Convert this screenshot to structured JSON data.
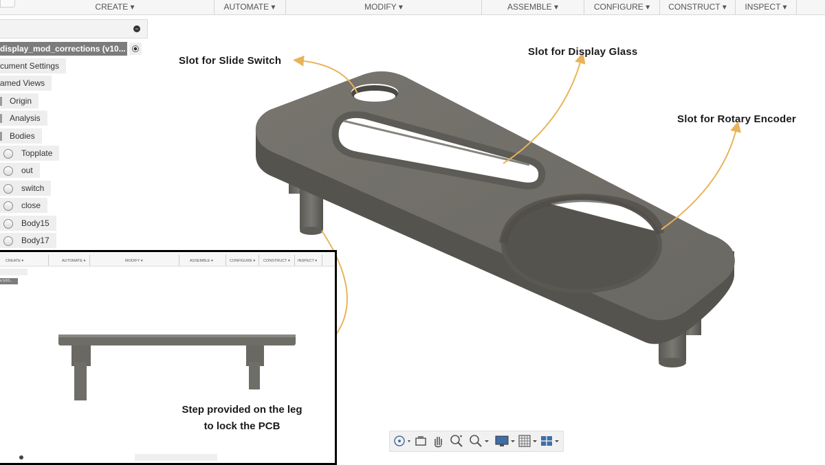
{
  "toolbar": {
    "menus": [
      {
        "label": "CREATE ▾"
      },
      {
        "label": "AUTOMATE ▾"
      },
      {
        "label": "MODIFY ▾"
      },
      {
        "label": "ASSEMBLE ▾"
      },
      {
        "label": "CONFIGURE ▾"
      },
      {
        "label": "CONSTRUCT ▾"
      },
      {
        "label": "INSPECT ▾"
      }
    ]
  },
  "browser": {
    "collapse_icon": "minus-circle-icon",
    "document_name": "display_mod_corrections (v10...",
    "items": [
      {
        "label": "cument Settings"
      },
      {
        "label": "amed Views"
      },
      {
        "label": "Origin"
      },
      {
        "label": "Analysis"
      },
      {
        "label": "Bodies"
      }
    ],
    "bodies": [
      {
        "label": "Topplate"
      },
      {
        "label": "out"
      },
      {
        "label": "switch"
      },
      {
        "label": "close"
      },
      {
        "label": "Body15"
      },
      {
        "label": "Body17"
      }
    ]
  },
  "callouts": {
    "slide_switch": "Slot for Slide Switch",
    "display_glass": "Slot for Display Glass",
    "rotary_encoder": "Slot for Rotary Encoder"
  },
  "inset": {
    "menus": [
      {
        "label": "CREATE ▾"
      },
      {
        "label": "AUTOMATE ▾"
      },
      {
        "label": "MODIFY ▾"
      },
      {
        "label": "ASSEMBLE ▾"
      },
      {
        "label": "CONFIGURE ▾"
      },
      {
        "label": "CONSTRUCT ▾"
      },
      {
        "label": "INSPECT ▾"
      }
    ],
    "doc_label": "s (v10...",
    "caption_line1": "Step provided on the leg",
    "caption_line2": "to lock the PCB"
  },
  "navbar": {
    "icons": [
      "orbit-icon",
      "look-at-icon",
      "pan-icon",
      "zoom-icon",
      "zoom-window-icon",
      "display-settings-icon",
      "grid-icon",
      "viewports-icon"
    ]
  },
  "colors": {
    "model": "#6e6c66",
    "model_dark": "#55534e",
    "callout_arrow": "#e8b35a",
    "toolbar_bg": "#f6f6f6",
    "selected_doc": "#7c7c7c"
  }
}
